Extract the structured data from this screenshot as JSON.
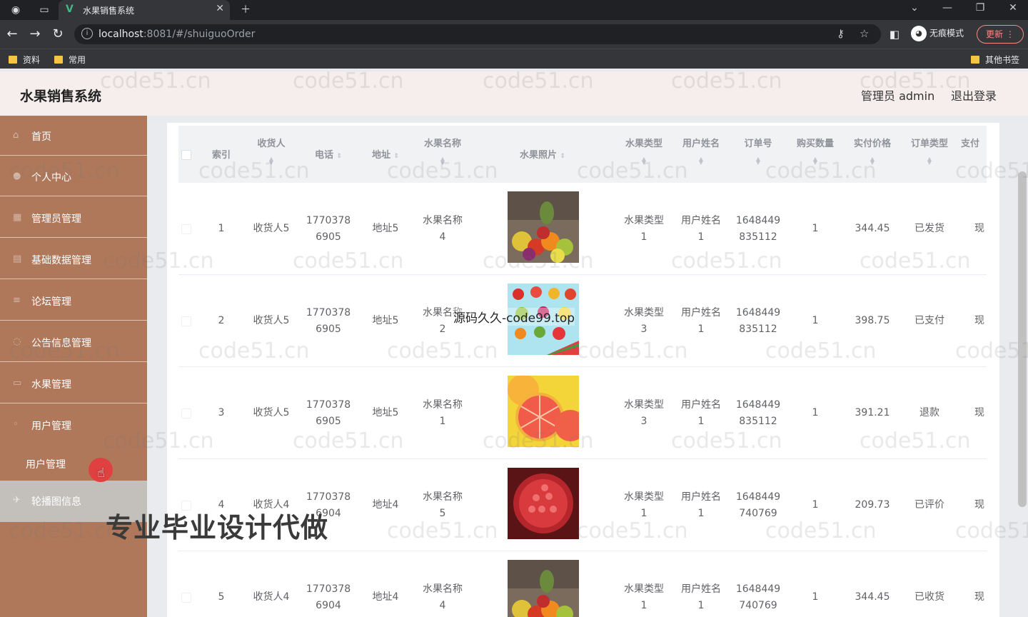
{
  "browser": {
    "tab_title": "水果销售系统",
    "url_host": "localhost",
    "url_rest": ":8081/#/shuiguoOrder",
    "incognito_label": "无痕模式",
    "update_label": "更新",
    "bookmarks": [
      "资料",
      "常用"
    ],
    "other_bookmarks": "其他书签"
  },
  "header": {
    "title": "水果销售系统",
    "admin_label": "管理员 admin",
    "logout_label": "退出登录"
  },
  "sidebar": {
    "items": [
      {
        "label": "首页",
        "icon": "home-icon"
      },
      {
        "label": "个人中心",
        "icon": "user-icon"
      },
      {
        "label": "管理员管理",
        "icon": "admin-icon"
      },
      {
        "label": "基础数据管理",
        "icon": "data-icon"
      },
      {
        "label": "论坛管理",
        "icon": "forum-icon"
      },
      {
        "label": "公告信息管理",
        "icon": "notice-icon"
      },
      {
        "label": "水果管理",
        "icon": "fruit-icon"
      },
      {
        "label": "用户管理",
        "icon": "users-icon"
      }
    ],
    "submenu_label": "用户管理",
    "hover_item": {
      "label": "轮播图信息",
      "icon": "carousel-icon"
    }
  },
  "table": {
    "columns": [
      "索引",
      "收货人",
      "电话",
      "地址",
      "水果名称",
      "水果照片",
      "水果类型",
      "用户姓名",
      "订单号",
      "购买数量",
      "实付价格",
      "订单类型",
      "支付"
    ],
    "rows": [
      {
        "index": "1",
        "receiver": "收货人5",
        "phone1": "1770378",
        "phone2": "6905",
        "address": "地址5",
        "name1": "水果名称",
        "name2": "4",
        "type1": "水果类型",
        "type2": "1",
        "user1": "用户姓名",
        "user2": "1",
        "order1": "1648449",
        "order2": "835112",
        "qty": "1",
        "price": "344.45",
        "status": "已发货",
        "pay": "现"
      },
      {
        "index": "2",
        "receiver": "收货人5",
        "phone1": "1770378",
        "phone2": "6905",
        "address": "地址5",
        "name1": "水果名称",
        "name2": "2",
        "type1": "水果类型",
        "type2": "3",
        "user1": "用户姓名",
        "user2": "1",
        "order1": "1648449",
        "order2": "835112",
        "qty": "1",
        "price": "398.75",
        "status": "已支付",
        "pay": "现"
      },
      {
        "index": "3",
        "receiver": "收货人5",
        "phone1": "1770378",
        "phone2": "6905",
        "address": "地址5",
        "name1": "水果名称",
        "name2": "1",
        "type1": "水果类型",
        "type2": "3",
        "user1": "用户姓名",
        "user2": "1",
        "order1": "1648449",
        "order2": "835112",
        "qty": "1",
        "price": "391.21",
        "status": "退款",
        "pay": "现"
      },
      {
        "index": "4",
        "receiver": "收货人4",
        "phone1": "1770378",
        "phone2": "6904",
        "address": "地址4",
        "name1": "水果名称",
        "name2": "5",
        "type1": "水果类型",
        "type2": "1",
        "user1": "用户姓名",
        "user2": "1",
        "order1": "1648449",
        "order2": "740769",
        "qty": "1",
        "price": "209.73",
        "status": "已评价",
        "pay": "现"
      },
      {
        "index": "5",
        "receiver": "收货人4",
        "phone1": "1770378",
        "phone2": "6904",
        "address": "地址4",
        "name1": "水果名称",
        "name2": "4",
        "type1": "水果类型",
        "type2": "1",
        "user1": "用户姓名",
        "user2": "1",
        "order1": "1648449",
        "order2": "740769",
        "qty": "1",
        "price": "344.45",
        "status": "已收货",
        "pay": "现"
      }
    ]
  },
  "watermark": "code51.cn",
  "overlay_text": "源码久久-code99.top",
  "big_overlay": "专业毕业设计代做",
  "colors": {
    "sidebar": "#b0785b",
    "header": "#f5eeed",
    "table_header": "#f1f2f4"
  }
}
